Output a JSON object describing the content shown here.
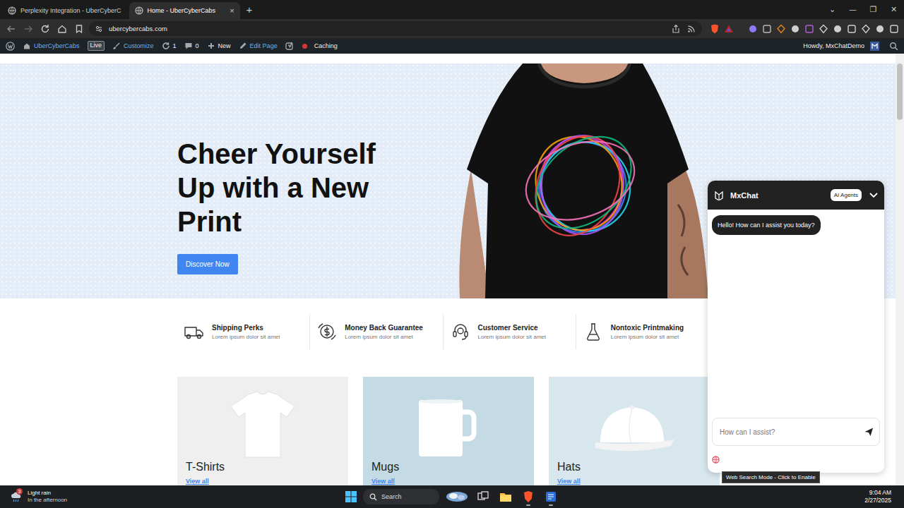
{
  "browser": {
    "tabs": [
      {
        "label": "Perplexity Integration - UberCyberC",
        "selected": false
      },
      {
        "label": "Home - UberCyberCabs",
        "selected": true,
        "close": "×"
      }
    ],
    "new_tab": "+",
    "window_controls": [
      "⌄",
      "—",
      "❐",
      "✕"
    ]
  },
  "address_bar": {
    "url": "ubercybercabs.com"
  },
  "admin_bar": {
    "items": [
      {
        "kind": "site",
        "label": "UberCyberCabs",
        "color": "#72aee6"
      },
      {
        "kind": "badge",
        "label": "Live",
        "color": "#f0f0f1"
      },
      {
        "kind": "customize",
        "label": "Customize",
        "color": "#72aee6"
      },
      {
        "kind": "updates",
        "label": "1",
        "color": "#f0f0f1"
      },
      {
        "kind": "comments",
        "label": "0",
        "color": "#f0f0f1"
      },
      {
        "kind": "new",
        "label": "New",
        "color": "#f0f0f1"
      },
      {
        "kind": "edit",
        "label": "Edit Page",
        "color": "#72aee6"
      },
      {
        "kind": "caching",
        "label": "Caching",
        "color": "#f0f0f1",
        "dot_color": "#d63638"
      }
    ],
    "greeting": "Howdy, MxChatDemo"
  },
  "hero": {
    "heading": "Cheer Yourself Up with a New Print",
    "button": "Discover Now"
  },
  "features": [
    {
      "kind": "shipping",
      "title": "Shipping Perks",
      "text": "Lorem ipsum dolor sit amet"
    },
    {
      "kind": "guarantee",
      "title": "Money Back Guarantee",
      "text": "Lorem ipsum dolor sit amet"
    },
    {
      "kind": "service",
      "title": "Customer Service",
      "text": "Lorem ipsum dolor sit amet"
    },
    {
      "kind": "printing",
      "title": "Nontoxic Printmaking",
      "text": "Lorem ipsum dolor sit amet"
    }
  ],
  "categories": [
    {
      "kind": "tshirt",
      "title": "T-Shirts",
      "link": "View all",
      "color": "#efefef"
    },
    {
      "kind": "mug",
      "title": "Mugs",
      "link": "View all",
      "color": "#c4dbe5"
    },
    {
      "kind": "hat",
      "title": "Hats",
      "link": "View all",
      "color": "#d8e6ed"
    }
  ],
  "chat": {
    "title": "MxChat",
    "agents_button": "AI Agents",
    "messages": [
      {
        "role": "bot",
        "text": "Hello! How can I assist you today?"
      }
    ],
    "input": {
      "placeholder": "How can I assist?"
    },
    "web_search": {
      "enabled": false,
      "tooltip": "Web Search Mode - Click to Enable"
    }
  },
  "taskbar": {
    "weather": {
      "badge": "3",
      "condition": "Light rain",
      "detail": "In the afternoon"
    },
    "search": {
      "label": "Search"
    },
    "clock": {
      "time": "9:04 AM",
      "date": "2/27/2025"
    }
  }
}
